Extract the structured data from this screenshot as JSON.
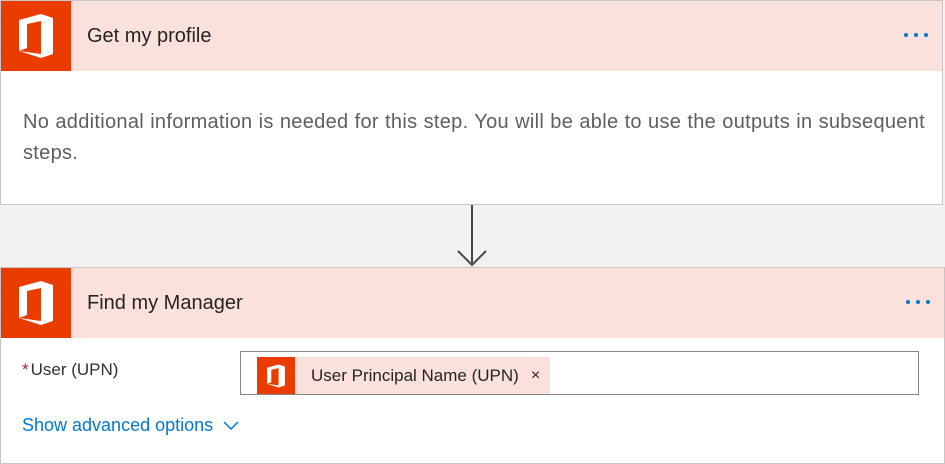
{
  "steps": [
    {
      "title": "Get my profile",
      "info": "No additional information is needed for this step. You will be able to use the outputs in subsequent steps.",
      "icon": "office-icon",
      "more_icon": "more-options-icon"
    },
    {
      "title": "Find my Manager",
      "icon": "office-icon",
      "more_icon": "more-options-icon",
      "field": {
        "required_marker": "*",
        "label": "User (UPN)",
        "token": {
          "icon": "office-icon",
          "text": "User Principal Name (UPN)",
          "remove": "×"
        }
      },
      "advanced_options": "Show advanced options",
      "advanced_icon": "chevron-down-icon"
    }
  ],
  "colors": {
    "office_red": "#eb3c00",
    "header_tint": "#fbe1dc",
    "link_blue": "#0078d4",
    "canvas": "#f3f2f1"
  }
}
